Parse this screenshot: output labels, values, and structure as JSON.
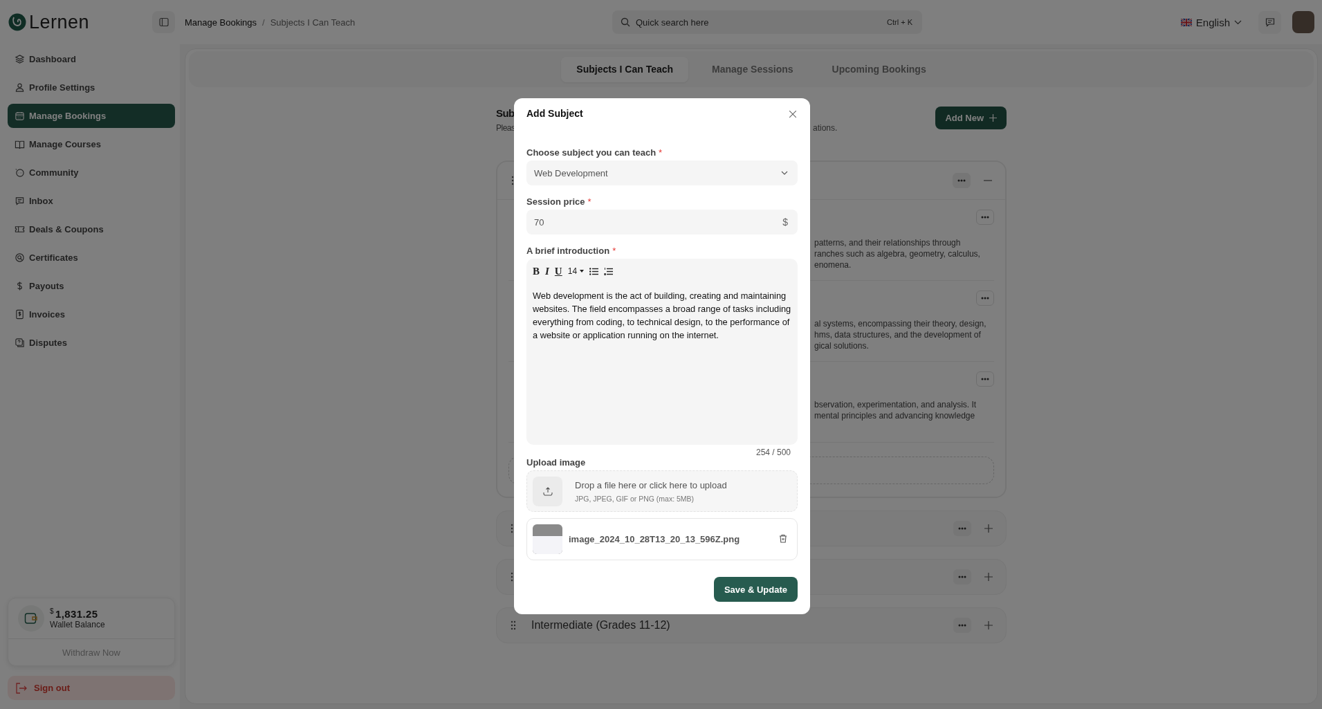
{
  "brand": {
    "name": "Lernen"
  },
  "breadcrumb": {
    "separator": "/",
    "items": [
      {
        "label": "Manage Bookings",
        "current": false
      },
      {
        "label": "Subjects I Can Teach",
        "current": true
      }
    ]
  },
  "search": {
    "placeholder": "Quick search here",
    "shortcut": "Ctrl + K"
  },
  "language": {
    "label": "English"
  },
  "sidebar": {
    "items": [
      {
        "label": "Dashboard",
        "selected": false
      },
      {
        "label": "Profile Settings",
        "selected": false
      },
      {
        "label": "Manage Bookings",
        "selected": true
      },
      {
        "label": "Manage Courses",
        "selected": false
      },
      {
        "label": "Community",
        "selected": false
      },
      {
        "label": "Inbox",
        "selected": false
      },
      {
        "label": "Deals & Coupons",
        "selected": false
      },
      {
        "label": "Certificates",
        "selected": false
      },
      {
        "label": "Payouts",
        "selected": false
      },
      {
        "label": "Invoices",
        "selected": false
      },
      {
        "label": "Disputes",
        "selected": false
      }
    ]
  },
  "wallet": {
    "currency": "$",
    "amount": "1,831.25",
    "label": "Wallet Balance",
    "action": "Withdraw Now"
  },
  "sign_out": {
    "label": "Sign out"
  },
  "tabs": [
    {
      "label": "Subjects I Can Teach",
      "selected": true
    },
    {
      "label": "Manage Sessions",
      "selected": false
    },
    {
      "label": "Upcoming Bookings",
      "selected": false
    }
  ],
  "page": {
    "title": "Sub",
    "subtitle_start": "Pleas",
    "subtitle_end": "ations.",
    "add_button": "Add New"
  },
  "groups": [
    {
      "expanded": true,
      "subjects": [
        {
          "description": "patterns, and their relationships through\nranches such as algebra, geometry, calculus,\nenomena."
        },
        {
          "description": "al systems, encompassing their theory, design,\nhms, data structures, and the development of\ngical solutions."
        },
        {
          "description": "bservation, experimentation, and analysis. It\nmental principles and advancing knowledge"
        }
      ]
    },
    {
      "expanded": false
    },
    {
      "expanded": false
    },
    {
      "expanded": false,
      "title": "Intermediate (Grades 11-12)"
    }
  ],
  "modal": {
    "title": "Add Subject",
    "fields": [
      {
        "kind": "select",
        "label": "Choose subject you can teach",
        "marker": "*",
        "value": "Web Development"
      },
      {
        "kind": "price",
        "label": "Session price",
        "marker": "*",
        "value": "70",
        "suffix": "$"
      },
      {
        "kind": "editor",
        "label": "A brief introduction",
        "marker": "*",
        "toolbar": [
          {
            "kind": "bold",
            "label": "B"
          },
          {
            "kind": "italic",
            "label": "I"
          },
          {
            "kind": "underline",
            "label": "U"
          },
          {
            "kind": "size",
            "label": "14"
          },
          {
            "kind": "bullets"
          },
          {
            "kind": "numbers"
          }
        ],
        "value": "Web development is the act of building, creating and maintaining websites. The field encompasses a broad range of tasks including everything from coding, to technical design, to the performance of a website or application running on the internet.",
        "counter": "254 / 500"
      }
    ],
    "upload": {
      "label": "Upload image",
      "prompt": "Drop a file here or click here to upload",
      "hint": "JPG, JPEG, GIF or PNG (max: 5MB)",
      "files": [
        {
          "name": "image_2024_10_28T13_20_13_596Z.png"
        }
      ]
    },
    "submit": "Save & Update"
  }
}
